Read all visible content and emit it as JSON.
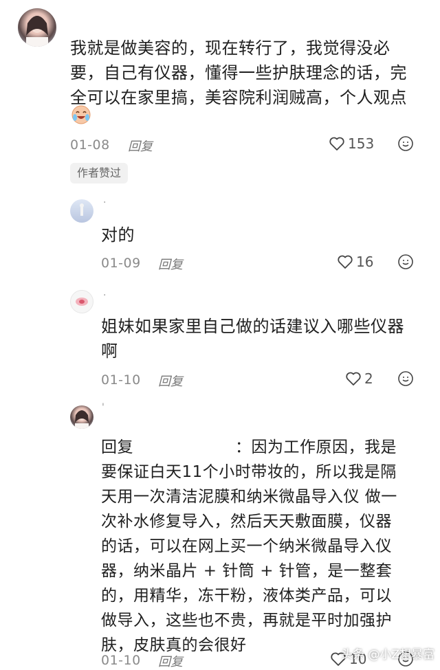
{
  "main_comment": {
    "text_lines": [
      "我就是做美容的，现在转行了，我觉得没必",
      "要，自己有仪器，懂得一些护肤理念的话，完",
      "全可以在家里搞，美容院利润贼高，个人观点"
    ],
    "emoji": "laughing-crying-emoji",
    "date": "01-08",
    "reply_label": "回复",
    "likes": "153",
    "badge": "作者赞过"
  },
  "replies": [
    {
      "name": ".",
      "text_lines": [
        "对的"
      ],
      "date": "01-09",
      "reply_label": "回复",
      "likes": "16"
    },
    {
      "name": ".",
      "text_lines": [
        "姐妹如果家里自己做的话建议入哪些仪器",
        "啊"
      ],
      "date": "01-10",
      "reply_label": "回复",
      "likes": "2"
    },
    {
      "name": "'",
      "reply_prefix": "回复",
      "text_lines": [
        "：因为工作原因，我是",
        "要保证白天11个小时带妆的，所以我是隔",
        "天用一次清洁泥膜和纳米微晶导入仪 做一",
        "次补水修复导入，然后天天敷面膜，仪器",
        "的话，可以在网上买一个纳米微晶导入仪",
        "器，纳米晶片 + 针筒 + 针管，是一整套",
        "的，用精华，冻干粉，液体类产品，可以",
        "做导入，这些也不贵，再就是平时加强护",
        "肤，皮肤真的会很好"
      ],
      "date": "01-10",
      "reply_label": "回复",
      "likes": "10"
    }
  ],
  "watermark": "头条 @小Z想暴富",
  "colors": {
    "text": "#1f1f1f",
    "meta": "#8a8a8a",
    "badge_bg": "#f1f1f1"
  }
}
